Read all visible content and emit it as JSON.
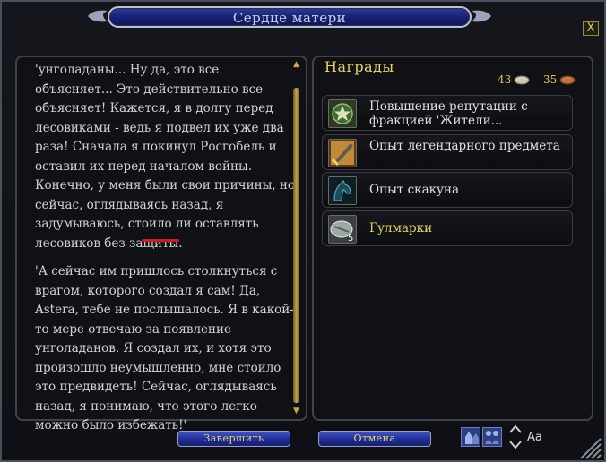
{
  "window": {
    "title": "Сердце матери",
    "close_label": "X"
  },
  "quest": {
    "paragraphs": [
      "'унголаданы... Ну да, это все объясняет... Это действительно все объясняет! Кажется, я в долгу перед лесовиками - ведь я подвел их уже два раза! Сначала я покинул Росгобель и оставил их перед началом войны. Конечно, у меня были свои причины, но сейчас, оглядываясь назад, я задумываюсь, стоило ли оставлять лесовиков без защиты.",
      "'А сейчас им пришлось столкнуться с врагом, которого создал я сам! Да, Astera, тебе не послышалось. Я в какой-то мере отвечаю за появление унголаданов. Я создал их, и хотя это произошло неумышленно, мне стоило это предвидеть! Сейчас, оглядываясь назад, я понимаю, что этого легко можно было избежать!'"
    ]
  },
  "rewards": {
    "header": "Награды",
    "currency": [
      {
        "value": "43",
        "icon": "silver-coin-icon",
        "color": "#c9c7a6"
      },
      {
        "value": "35",
        "icon": "copper-coin-icon",
        "color": "#b86d3a"
      }
    ],
    "items": [
      {
        "label": "Повышение репутации с фракцией 'Жители...",
        "icon": "reputation-icon",
        "highlight": false
      },
      {
        "label": "Опыт легендарного предмета",
        "icon": "legendary-item-icon",
        "highlight": false
      },
      {
        "label": "Опыт скакуна",
        "icon": "mount-icon",
        "highlight": false
      },
      {
        "label": "Гулмарки",
        "icon": "mark-token-icon",
        "count": "5",
        "highlight": true
      }
    ]
  },
  "buttons": {
    "complete": "Завершить",
    "cancel": "Отмена"
  },
  "font_control": {
    "label": "Aa"
  },
  "colors": {
    "gold": "#e6d35a",
    "title_blue": "#162072",
    "underline_red": "#d21a1a"
  }
}
